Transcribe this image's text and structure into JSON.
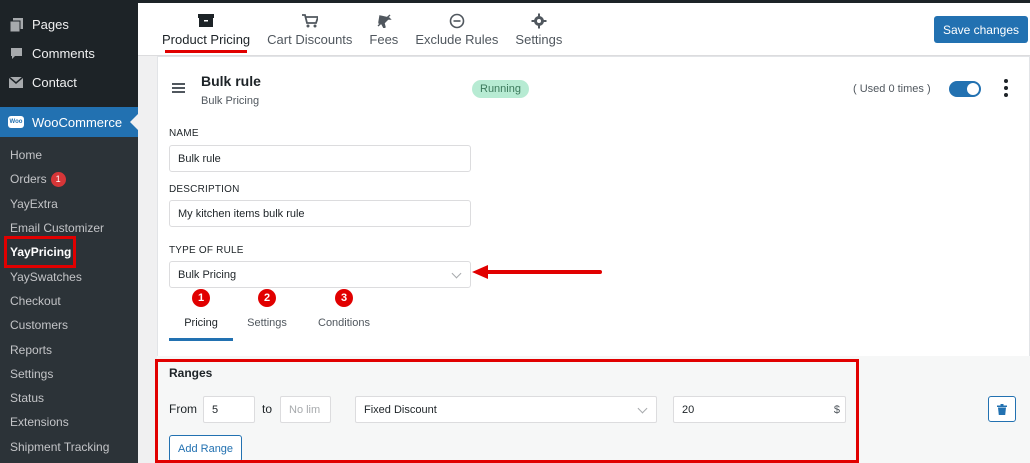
{
  "sidebar": {
    "top_items": [
      {
        "label": "Pages",
        "icon": "pages-icon"
      },
      {
        "label": "Comments",
        "icon": "comments-icon"
      },
      {
        "label": "Contact",
        "icon": "mail-icon"
      }
    ],
    "woocommerce": {
      "label": "WooCommerce",
      "logo_text": "Woo"
    },
    "sub_items": [
      {
        "label": "Home"
      },
      {
        "label": "Orders",
        "badge": "1"
      },
      {
        "label": "YayExtra"
      },
      {
        "label": "Email Customizer"
      },
      {
        "label": "YayPricing"
      },
      {
        "label": "YaySwatches"
      },
      {
        "label": "Checkout"
      },
      {
        "label": "Customers"
      },
      {
        "label": "Reports"
      },
      {
        "label": "Settings"
      },
      {
        "label": "Status"
      },
      {
        "label": "Extensions"
      },
      {
        "label": "Shipment Tracking"
      }
    ]
  },
  "header": {
    "tabs": [
      {
        "label": "Product Pricing",
        "icon": "box-icon"
      },
      {
        "label": "Cart Discounts",
        "icon": "cart-icon"
      },
      {
        "label": "Fees",
        "icon": "plane-icon"
      },
      {
        "label": "Exclude Rules",
        "icon": "minus-circle-icon"
      },
      {
        "label": "Settings",
        "icon": "gear-icon"
      }
    ],
    "save_label": "Save changes"
  },
  "rule": {
    "title": "Bulk rule",
    "subtitle": "Bulk Pricing",
    "status": "Running",
    "used": "( Used 0 times )",
    "enabled": true
  },
  "form": {
    "name_label": "NAME",
    "name_value": "Bulk rule",
    "description_label": "DESCRIPTION",
    "description_value": "My kitchen items bulk rule",
    "type_label": "TYPE OF RULE",
    "type_value": "Bulk Pricing"
  },
  "sub_tabs": [
    {
      "label": "Pricing",
      "num": "1"
    },
    {
      "label": "Settings",
      "num": "2"
    },
    {
      "label": "Conditions",
      "num": "3"
    }
  ],
  "ranges": {
    "title": "Ranges",
    "from_label": "From",
    "from_value": "5",
    "to_label": "to",
    "to_placeholder": "No lim",
    "discount_type": "Fixed Discount",
    "amount": "20",
    "currency": "$",
    "add_label": "Add Range"
  },
  "colors": {
    "accent": "#2271b1",
    "highlight": "#e10000",
    "sidebar": "#1d2327"
  }
}
